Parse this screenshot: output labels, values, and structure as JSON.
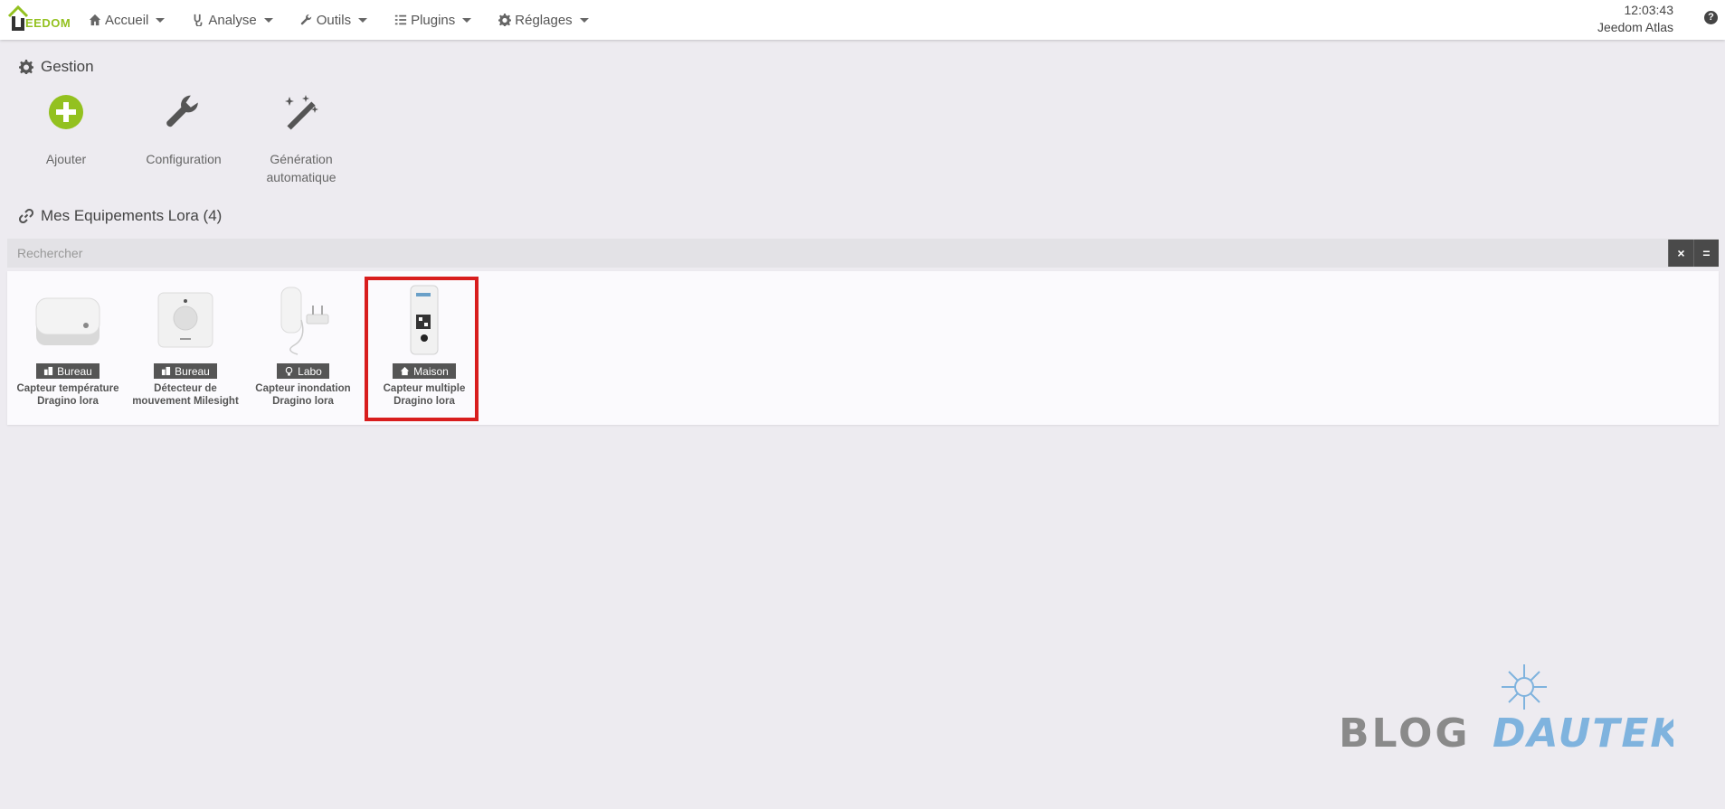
{
  "navbar": {
    "logo_text": "EEDOM",
    "menu": [
      {
        "label": "Accueil",
        "icon": "home-icon"
      },
      {
        "label": "Analyse",
        "icon": "stethoscope-icon"
      },
      {
        "label": "Outils",
        "icon": "wrench-icon"
      },
      {
        "label": "Plugins",
        "icon": "list-icon"
      },
      {
        "label": "Réglages",
        "icon": "gear-icon"
      }
    ],
    "time": "12:03:43",
    "system_name": "Jeedom Atlas",
    "help": "?"
  },
  "gestion": {
    "title": "Gestion",
    "cards": [
      {
        "label": "Ajouter",
        "icon": "plus-circle-icon"
      },
      {
        "label": "Configuration",
        "icon": "wrench-icon"
      },
      {
        "label_line1": "Génération",
        "label_line2": "automatique",
        "icon": "magic-wand-icon"
      }
    ]
  },
  "equipements": {
    "title": "Mes Equipements Lora (4)",
    "search_placeholder": "Rechercher",
    "clear_button": "×",
    "toggle_button": "=",
    "items": [
      {
        "room": "Bureau",
        "room_icon": "office-icon",
        "name_line1": "Capteur température",
        "name_line2": "Dragino lora",
        "highlighted": false
      },
      {
        "room": "Bureau",
        "room_icon": "office-icon",
        "name_line1": "Détecteur de",
        "name_line2": "mouvement Milesight",
        "highlighted": false
      },
      {
        "room": "Labo",
        "room_icon": "lightbulb-icon",
        "name_line1": "Capteur inondation",
        "name_line2": "Dragino lora",
        "highlighted": false
      },
      {
        "room": "Maison",
        "room_icon": "house-icon",
        "name_line1": "Capteur multiple",
        "name_line2": "Dragino lora",
        "highlighted": true
      }
    ]
  },
  "watermark": {
    "word1": "BLOG",
    "word2": "DAUTEK",
    "color1": "#8a8a8a",
    "color2": "#7fb3de"
  },
  "colors": {
    "accent_green": "#93c11f",
    "highlight_red": "#d81d1d",
    "background": "#edebf0"
  }
}
